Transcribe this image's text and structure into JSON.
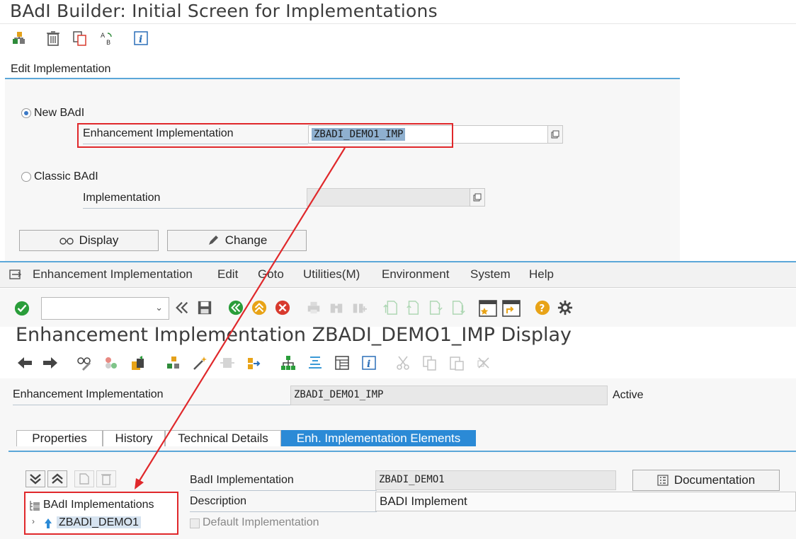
{
  "top_window": {
    "title": "BAdI Builder: Initial Screen for Implementations",
    "toolbar_icons": [
      "hierarchy-icon",
      "trash-icon",
      "copy-icon",
      "rename-icon",
      "info-icon"
    ],
    "group_title": "Edit Implementation",
    "new_badi_label": "New BAdI",
    "enh_impl_label": "Enhancement Implementation",
    "enh_impl_value": "ZBADI_DEMO1_IMP",
    "classic_badi_label": "Classic BAdI",
    "implementation_label": "Implementation",
    "implementation_value": "",
    "display_button": "Display",
    "change_button": "Change"
  },
  "menubar": {
    "items": [
      {
        "label": "Enhancement Implementation"
      },
      {
        "label": "Edit"
      },
      {
        "label": "Goto"
      },
      {
        "label": "Utilities(M)"
      },
      {
        "label": "Environment"
      },
      {
        "label": "System"
      },
      {
        "label": "Help"
      }
    ]
  },
  "command_field": {
    "value": ""
  },
  "lower_window": {
    "title": "Enhancement Implementation ZBADI_DEMO1_IMP Display",
    "enh_impl_label": "Enhancement Implementation",
    "enh_impl_value": "ZBADI_DEMO1_IMP",
    "status": "Active",
    "tabs": [
      {
        "label": "Properties"
      },
      {
        "label": "History"
      },
      {
        "label": "Technical Details"
      },
      {
        "label": "Enh. Implementation Elements"
      }
    ],
    "active_tab": "Enh. Implementation Elements",
    "tree_header": "BAdI Implementations",
    "tree_item": "ZBADI_DEMO1",
    "badi_impl_label": "BadI Implementation",
    "badi_impl_value": "ZBADI_DEMO1",
    "documentation_button": "Documentation",
    "description_label": "Description",
    "description_value": "BADI Implement",
    "default_impl_label": "Default Implementation"
  },
  "colors": {
    "accent_blue": "#2b8ad6",
    "highlight_red": "#e0282b",
    "ok_green": "#2a9d3a",
    "cancel_red": "#d83a2e",
    "exit_orange": "#e8a317"
  }
}
